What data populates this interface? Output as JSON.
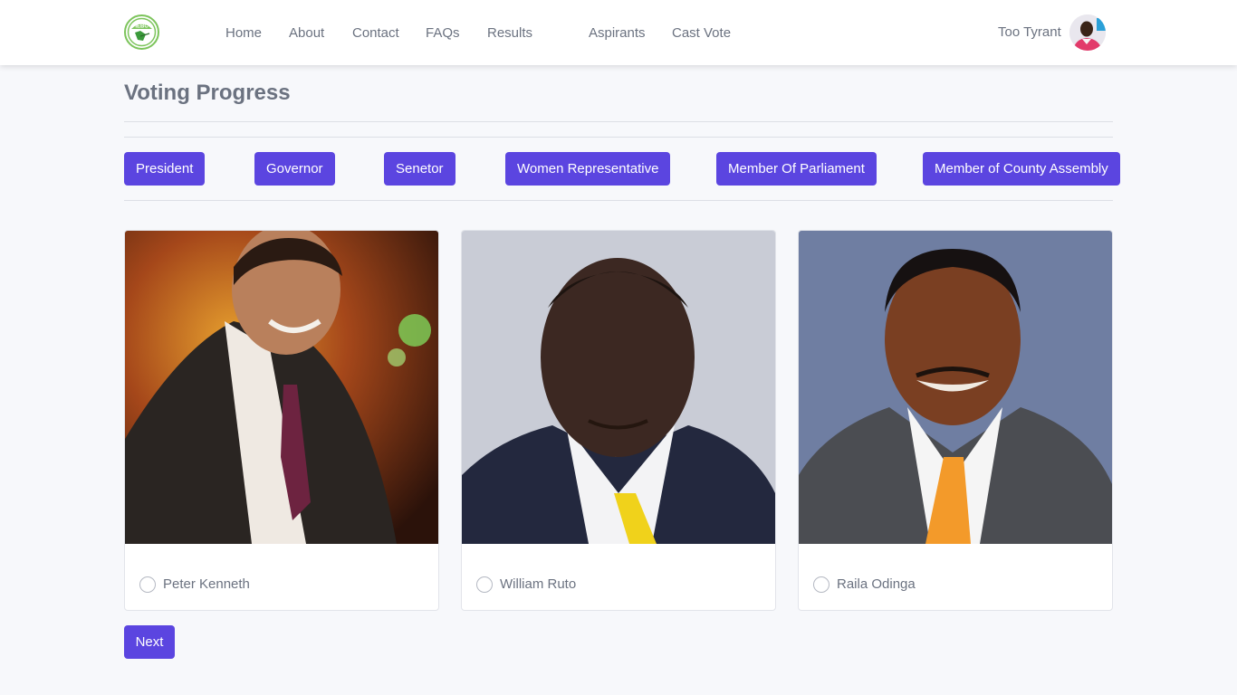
{
  "nav": {
    "logo_text": "IEBC",
    "links": [
      "Home",
      "About",
      "Contact",
      "FAQs",
      "Results",
      "Aspirants",
      "Cast Vote"
    ],
    "user_name": "Too Tyrant"
  },
  "page": {
    "title": "Voting Progress"
  },
  "positions": [
    "President",
    "Governor",
    "Senetor",
    "Women Representative",
    "Member Of Parliament",
    "Member of County Assembly"
  ],
  "candidates": [
    {
      "name": "Peter Kenneth",
      "selected": false
    },
    {
      "name": "William Ruto",
      "selected": false
    },
    {
      "name": "Raila Odinga",
      "selected": false
    }
  ],
  "actions": {
    "next_label": "Next"
  },
  "colors": {
    "accent": "#5b45e0",
    "background": "#f7f8fb",
    "text": "#6b7280",
    "logo_green": "#7cc45b"
  }
}
